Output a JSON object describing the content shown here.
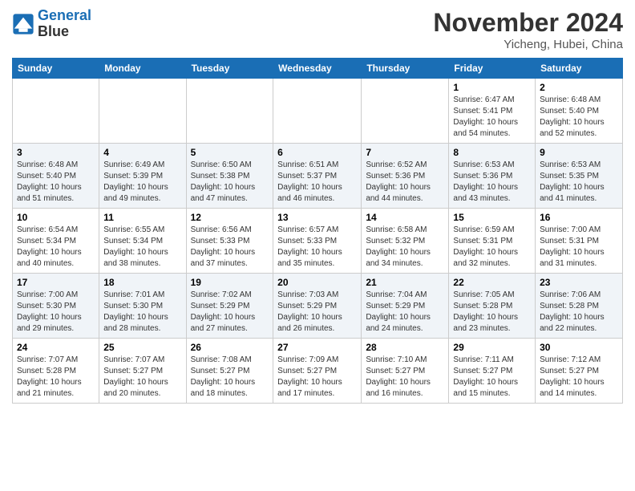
{
  "header": {
    "logo_line1": "General",
    "logo_line2": "Blue",
    "month_title": "November 2024",
    "location": "Yicheng, Hubei, China"
  },
  "weekdays": [
    "Sunday",
    "Monday",
    "Tuesday",
    "Wednesday",
    "Thursday",
    "Friday",
    "Saturday"
  ],
  "weeks": [
    [
      {
        "day": "",
        "info": ""
      },
      {
        "day": "",
        "info": ""
      },
      {
        "day": "",
        "info": ""
      },
      {
        "day": "",
        "info": ""
      },
      {
        "day": "",
        "info": ""
      },
      {
        "day": "1",
        "info": "Sunrise: 6:47 AM\nSunset: 5:41 PM\nDaylight: 10 hours\nand 54 minutes."
      },
      {
        "day": "2",
        "info": "Sunrise: 6:48 AM\nSunset: 5:40 PM\nDaylight: 10 hours\nand 52 minutes."
      }
    ],
    [
      {
        "day": "3",
        "info": "Sunrise: 6:48 AM\nSunset: 5:40 PM\nDaylight: 10 hours\nand 51 minutes."
      },
      {
        "day": "4",
        "info": "Sunrise: 6:49 AM\nSunset: 5:39 PM\nDaylight: 10 hours\nand 49 minutes."
      },
      {
        "day": "5",
        "info": "Sunrise: 6:50 AM\nSunset: 5:38 PM\nDaylight: 10 hours\nand 47 minutes."
      },
      {
        "day": "6",
        "info": "Sunrise: 6:51 AM\nSunset: 5:37 PM\nDaylight: 10 hours\nand 46 minutes."
      },
      {
        "day": "7",
        "info": "Sunrise: 6:52 AM\nSunset: 5:36 PM\nDaylight: 10 hours\nand 44 minutes."
      },
      {
        "day": "8",
        "info": "Sunrise: 6:53 AM\nSunset: 5:36 PM\nDaylight: 10 hours\nand 43 minutes."
      },
      {
        "day": "9",
        "info": "Sunrise: 6:53 AM\nSunset: 5:35 PM\nDaylight: 10 hours\nand 41 minutes."
      }
    ],
    [
      {
        "day": "10",
        "info": "Sunrise: 6:54 AM\nSunset: 5:34 PM\nDaylight: 10 hours\nand 40 minutes."
      },
      {
        "day": "11",
        "info": "Sunrise: 6:55 AM\nSunset: 5:34 PM\nDaylight: 10 hours\nand 38 minutes."
      },
      {
        "day": "12",
        "info": "Sunrise: 6:56 AM\nSunset: 5:33 PM\nDaylight: 10 hours\nand 37 minutes."
      },
      {
        "day": "13",
        "info": "Sunrise: 6:57 AM\nSunset: 5:33 PM\nDaylight: 10 hours\nand 35 minutes."
      },
      {
        "day": "14",
        "info": "Sunrise: 6:58 AM\nSunset: 5:32 PM\nDaylight: 10 hours\nand 34 minutes."
      },
      {
        "day": "15",
        "info": "Sunrise: 6:59 AM\nSunset: 5:31 PM\nDaylight: 10 hours\nand 32 minutes."
      },
      {
        "day": "16",
        "info": "Sunrise: 7:00 AM\nSunset: 5:31 PM\nDaylight: 10 hours\nand 31 minutes."
      }
    ],
    [
      {
        "day": "17",
        "info": "Sunrise: 7:00 AM\nSunset: 5:30 PM\nDaylight: 10 hours\nand 29 minutes."
      },
      {
        "day": "18",
        "info": "Sunrise: 7:01 AM\nSunset: 5:30 PM\nDaylight: 10 hours\nand 28 minutes."
      },
      {
        "day": "19",
        "info": "Sunrise: 7:02 AM\nSunset: 5:29 PM\nDaylight: 10 hours\nand 27 minutes."
      },
      {
        "day": "20",
        "info": "Sunrise: 7:03 AM\nSunset: 5:29 PM\nDaylight: 10 hours\nand 26 minutes."
      },
      {
        "day": "21",
        "info": "Sunrise: 7:04 AM\nSunset: 5:29 PM\nDaylight: 10 hours\nand 24 minutes."
      },
      {
        "day": "22",
        "info": "Sunrise: 7:05 AM\nSunset: 5:28 PM\nDaylight: 10 hours\nand 23 minutes."
      },
      {
        "day": "23",
        "info": "Sunrise: 7:06 AM\nSunset: 5:28 PM\nDaylight: 10 hours\nand 22 minutes."
      }
    ],
    [
      {
        "day": "24",
        "info": "Sunrise: 7:07 AM\nSunset: 5:28 PM\nDaylight: 10 hours\nand 21 minutes."
      },
      {
        "day": "25",
        "info": "Sunrise: 7:07 AM\nSunset: 5:27 PM\nDaylight: 10 hours\nand 20 minutes."
      },
      {
        "day": "26",
        "info": "Sunrise: 7:08 AM\nSunset: 5:27 PM\nDaylight: 10 hours\nand 18 minutes."
      },
      {
        "day": "27",
        "info": "Sunrise: 7:09 AM\nSunset: 5:27 PM\nDaylight: 10 hours\nand 17 minutes."
      },
      {
        "day": "28",
        "info": "Sunrise: 7:10 AM\nSunset: 5:27 PM\nDaylight: 10 hours\nand 16 minutes."
      },
      {
        "day": "29",
        "info": "Sunrise: 7:11 AM\nSunset: 5:27 PM\nDaylight: 10 hours\nand 15 minutes."
      },
      {
        "day": "30",
        "info": "Sunrise: 7:12 AM\nSunset: 5:27 PM\nDaylight: 10 hours\nand 14 minutes."
      }
    ]
  ]
}
